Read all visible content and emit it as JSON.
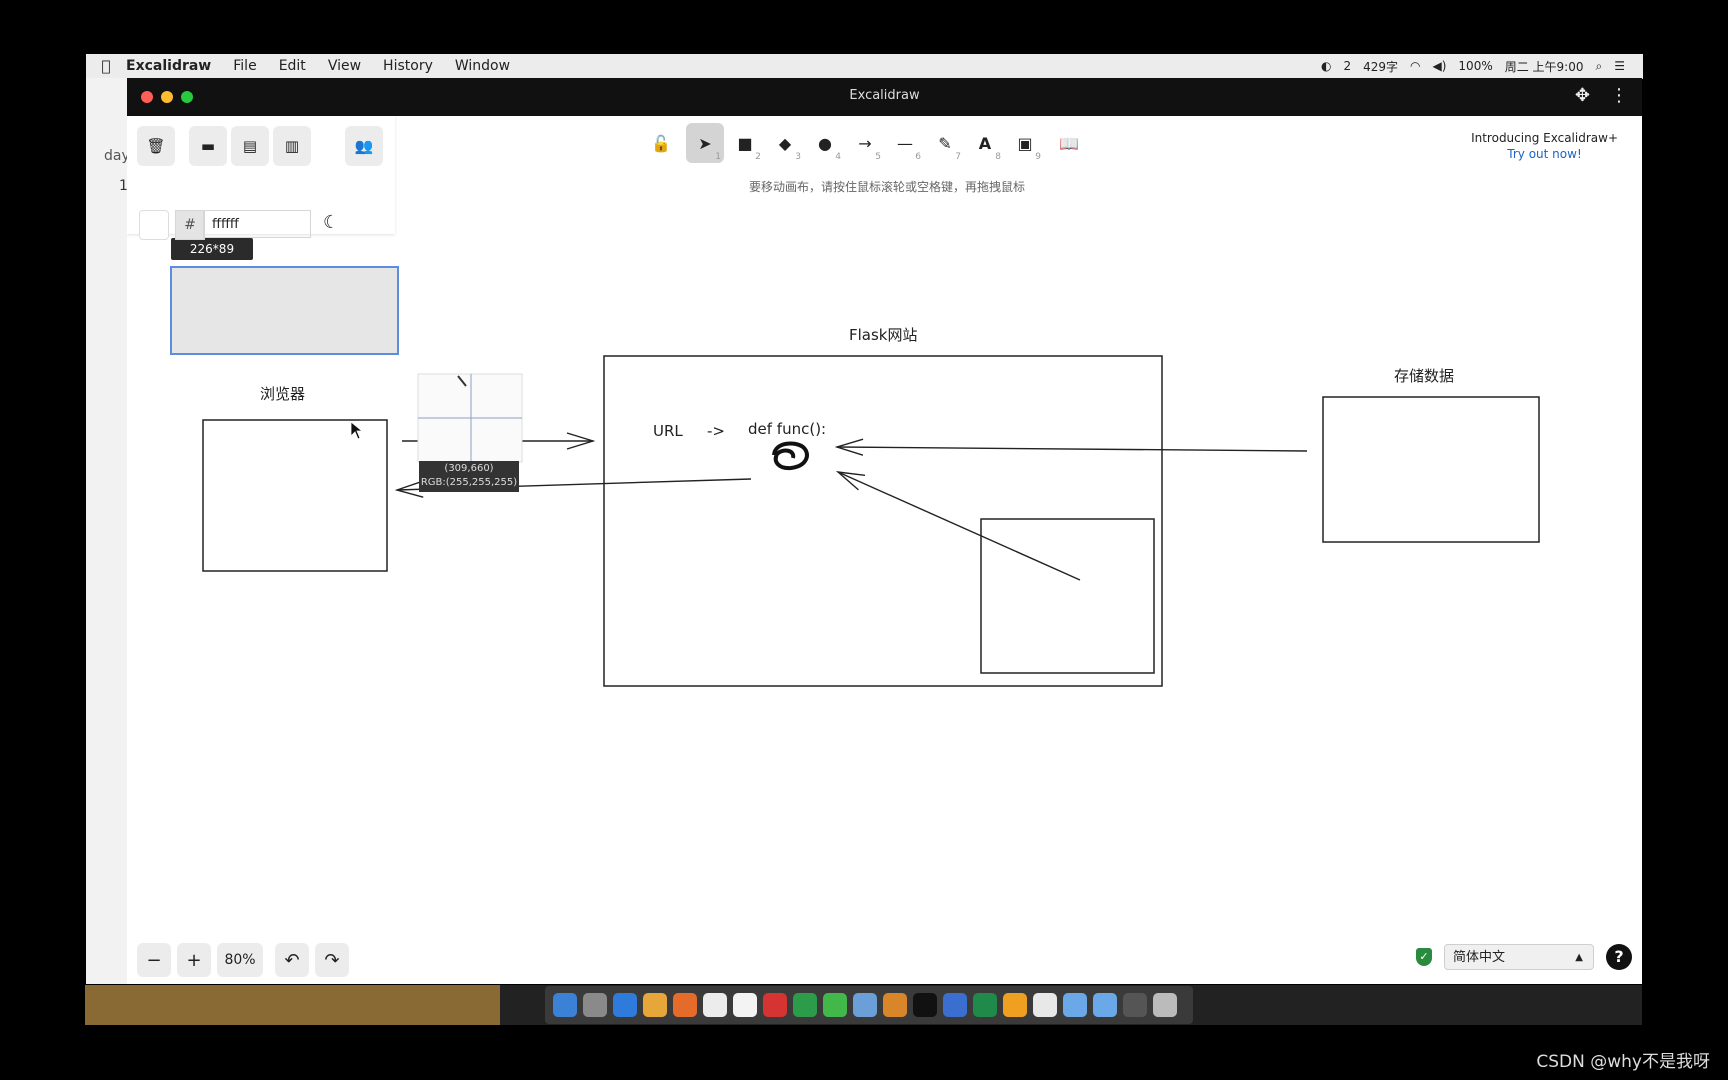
{
  "menubar": {
    "app_name": "Excalidraw",
    "items": [
      "File",
      "Edit",
      "View",
      "History",
      "Window"
    ],
    "status": {
      "notifications": "2",
      "word_count": "429字",
      "battery": "100%",
      "clock": "周二 上午9:00"
    }
  },
  "behind_window_text": {
    "t1": "day",
    "t2": "1"
  },
  "window": {
    "title": "Excalidraw"
  },
  "panel": {
    "hex_prefix": "#",
    "hex_value": "ffffff",
    "icons": [
      "trash-icon",
      "open-folder-icon",
      "save-file-icon",
      "export-file-icon",
      "collaboration-icon",
      "moon-icon"
    ]
  },
  "toolbar": {
    "tools": [
      {
        "name": "lock",
        "key": ""
      },
      {
        "name": "selection",
        "key": "1"
      },
      {
        "name": "rectangle",
        "key": "2"
      },
      {
        "name": "diamond",
        "key": "3"
      },
      {
        "name": "ellipse",
        "key": "4"
      },
      {
        "name": "arrow",
        "key": "5"
      },
      {
        "name": "line",
        "key": "6"
      },
      {
        "name": "draw",
        "key": "7"
      },
      {
        "name": "text",
        "key": "8"
      },
      {
        "name": "image",
        "key": "9"
      },
      {
        "name": "library",
        "key": ""
      }
    ],
    "hint": "要移动画布，请按住鼠标滚轮或空格键，再拖拽鼠标"
  },
  "promo": {
    "line1": "Introducing Excalidraw+",
    "line2": "Try out now!"
  },
  "size_badge": "226*89",
  "diagram": {
    "browser_label": "浏览器",
    "flask_label": "Flask网站",
    "storage_label": "存储数据",
    "url_label": "URL",
    "arrow_text": "->",
    "func_label": "def func():"
  },
  "tooltip": {
    "line1": "(309,660)",
    "line2": "RGB:(255,255,255)"
  },
  "zoom": {
    "minus": "−",
    "plus": "+",
    "percent": "80%"
  },
  "language": "简体中文",
  "help": "?",
  "watermark": "CSDN @why不是我呀"
}
